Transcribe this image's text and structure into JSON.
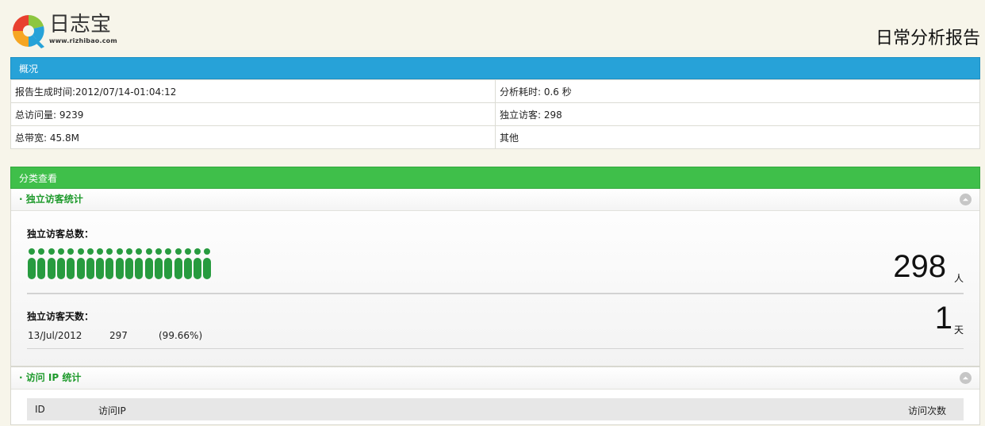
{
  "header": {
    "logo_name": "日志宝",
    "logo_url": "www.rizhibao.com",
    "report_title": "日常分析报告"
  },
  "overview": {
    "title": "概况",
    "rows": [
      [
        "报告生成时间:2012/07/14-01:04:12",
        "分析耗时: 0.6 秒"
      ],
      [
        "总访问量: 9239",
        "独立访客: 298"
      ],
      [
        "总带宽: 45.8M",
        "其他"
      ]
    ]
  },
  "category": {
    "title": "分类查看"
  },
  "uv_panel": {
    "title": "· 独立访客统计",
    "total_label": "独立访客总数：",
    "total_value": "298",
    "total_unit": "人",
    "days_label": "独立访客天数：",
    "days_value": "1",
    "days_unit": "天",
    "day_rows": [
      {
        "date": "13/Jul/2012",
        "count": "297",
        "percent": "(99.66%)"
      }
    ],
    "pill_count": 19
  },
  "ip_panel": {
    "title": "· 访问 IP 统计",
    "columns": [
      "ID",
      "访问IP",
      "访问次数"
    ]
  },
  "colors": {
    "blue_bar": "#27a2d8",
    "green_bar": "#3fbf4a",
    "pill_green": "#279b3f",
    "panel_title_green": "#1e9a2c"
  }
}
